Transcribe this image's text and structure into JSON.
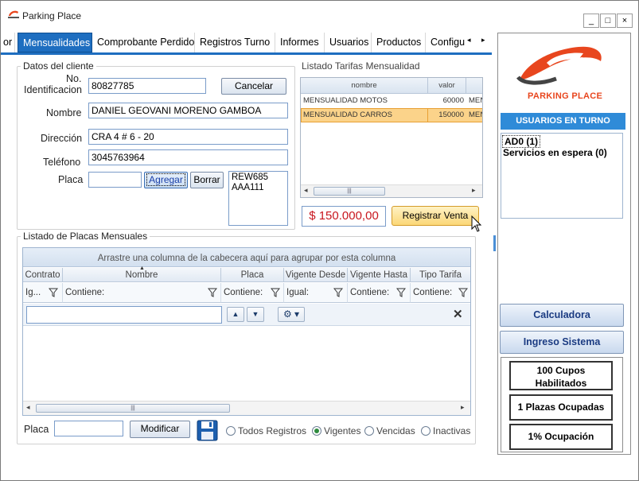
{
  "window": {
    "title": "Parking Place",
    "minimize": "_",
    "maximize": "□",
    "close": "×"
  },
  "tabs": {
    "items": [
      "or",
      "Mensualidades",
      "Comprobante Perdido",
      "Registros Turno",
      "Informes",
      "Usuarios",
      "Productos",
      "Configu"
    ],
    "active": "Mensualidades",
    "scroll_left": "◂",
    "scroll_right": "▸"
  },
  "cliente": {
    "group_title": "Datos del cliente",
    "id_label_1": "No.",
    "id_label_2": "Identificacion",
    "id_value": "80827785",
    "cancel_label": "Cancelar",
    "nombre_label": "Nombre",
    "nombre_value": "DANIEL GEOVANI MORENO GAMBOA",
    "direccion_label": "Dirección",
    "direccion_value": "CRA 4 # 6 - 20",
    "telefono_label": "Teléfono",
    "telefono_value": "3045763964",
    "placa_label": "Placa",
    "placa_value": "",
    "agregar_label": "Agregar",
    "borrar_label": "Borrar",
    "placas": [
      "REW685",
      "AAA111"
    ]
  },
  "tarifas": {
    "title": "Listado Tarifas Mensualidad",
    "columns": [
      "nombre",
      "valor",
      ""
    ],
    "rows": [
      [
        "MENSUALIDAD MOTOS",
        "60000",
        "MEN"
      ],
      [
        "MENSUALIDAD CARROS",
        "150000",
        "MEN"
      ]
    ],
    "selected_row": 1,
    "scroll_thumb": "|||",
    "total": "$ 150.000,00",
    "registrar_label": "Registrar Venta"
  },
  "placas_mensuales": {
    "title": "Listado de Placas Mensuales",
    "group_hint": "Arrastre una columna de la cabecera aquí para agrupar por esta columna",
    "columns": [
      "Contrato",
      "Nombre",
      "Placa",
      "Vigente Desde",
      "Vigente Hasta",
      "Tipo Tarifa"
    ],
    "filters": [
      "Ig...",
      "Contiene:",
      "Contiene:",
      "Igual:",
      "Contiene:",
      "Contiene:"
    ],
    "search_value": "",
    "up_label": "▲",
    "down_label": "▼",
    "settings_label": "⚙ ▾",
    "clear_label": "✕",
    "scroll_thumb": "|||",
    "placa_label": "Placa",
    "placa_value": "",
    "modificar_label": "Modificar",
    "radios": [
      "Todos Registros",
      "Vigentes",
      "Vencidas",
      "Inactivas"
    ],
    "radio_selected": "Vigentes"
  },
  "right_panel": {
    "logo_text": "PARKING PLACE",
    "usuarios_header": "USUARIOS EN TURNO",
    "usuarios": [
      "AD0 (1)",
      "Servicios en espera (0)"
    ],
    "calculadora_label": "Calculadora",
    "ingreso_label": "Ingreso Sistema",
    "cupos": "100 Cupos Habilitados",
    "ocupadas": "1 Plazas Ocupadas",
    "ocupacion": "1% Ocupación"
  },
  "colors": {
    "tab_active": "#1e6ec0",
    "usuarios_header": "#2f8bd8",
    "total_text": "#c8161e",
    "row_selected": "#fbd38a",
    "logo_orange": "#e8461e"
  }
}
